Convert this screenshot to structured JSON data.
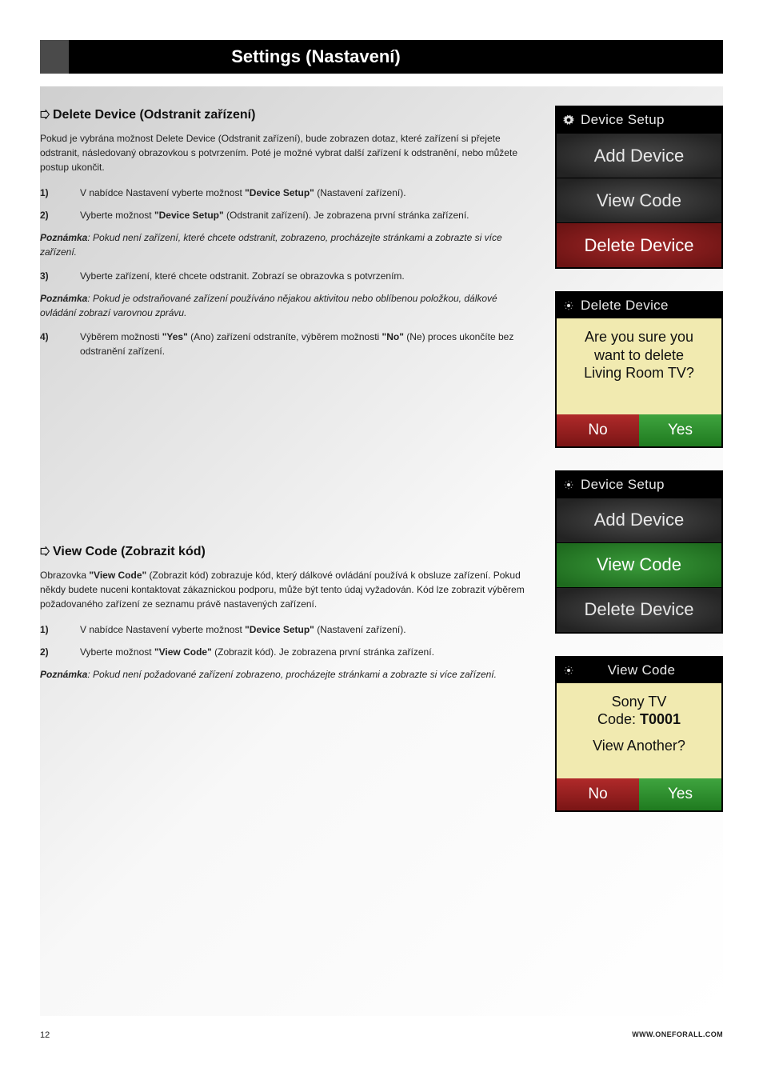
{
  "header": {
    "title": "Settings (Nastavení)"
  },
  "section1": {
    "heading": "Delete Device (Odstranit zařízení)",
    "intro": "Pokud je vybrána možnost Delete Device (Odstranit zařízení), bude zobrazen dotaz, které zařízení si přejete odstranit, následovaný obrazovkou s potvrzením. Poté je možné vybrat další zařízení k odstranění, nebo můžete postup ukončit.",
    "steps": [
      {
        "n": "1)",
        "pre": "V nabídce Nastavení vyberte možnost ",
        "bold": "\"Device Setup\"",
        "post": " (Nastavení zařízení)."
      },
      {
        "n": "2)",
        "pre": "Vyberte možnost ",
        "bold": "\"Device Setup\"",
        "post": " (Odstranit zařízení). Je zobrazena první stránka zařízení."
      }
    ],
    "note1_label": "Poznámka",
    "note1_text": ": Pokud není zařízení, které chcete odstranit, zobrazeno, procházejte stránkami a zobrazte si více zařízení.",
    "step3": {
      "n": "3)",
      "text": "Vyberte zařízení, které chcete odstranit. Zobrazí se obrazovka s potvrzením."
    },
    "note2_label": "Poznámka",
    "note2_text": ": Pokud je odstraňované zařízení používáno nějakou aktivitou nebo oblíbenou položkou, dálkové ovládání zobrazí varovnou zprávu.",
    "step4": {
      "n": "4)",
      "pre": "Výběrem možnosti ",
      "b1": "\"Yes\"",
      "mid": " (Ano) zařízení odstraníte, výběrem možnosti ",
      "b2": "\"No\"",
      "post": " (Ne) proces ukončíte bez odstranění zařízení."
    }
  },
  "section2": {
    "heading": "View Code (Zobrazit kód)",
    "intro_pre": "Obrazovka ",
    "intro_bold": "\"View Code\"",
    "intro_post": " (Zobrazit kód) zobrazuje kód, který dálkové ovládání používá k obsluze zařízení. Pokud někdy budete nuceni kontaktovat zákaznickou podporu, může být tento údaj vyžadován.  Kód lze zobrazit výběrem požadovaného zařízení ze seznamu právě nastavených zařízení.",
    "steps": [
      {
        "n": "1)",
        "pre": "V nabídce Nastavení vyberte možnost ",
        "bold": "\"Device Setup\"",
        "post": " (Nastavení zařízení)."
      },
      {
        "n": "2)",
        "pre": "Vyberte možnost ",
        "bold": "\"View Code\"",
        "post": " (Zobrazit kód). Je zobrazena první stránka zařízení."
      }
    ],
    "note_label": "Poznámka",
    "note_text": ": Pokud není požadované zařízení zobrazeno, procházejte stránkami a zobrazte si více zařízení."
  },
  "screens": {
    "s1": {
      "title": "Device Setup",
      "items": [
        "Add Device",
        "View Code",
        "Delete Device"
      ],
      "highlight": 2
    },
    "s2": {
      "title": "Delete Device",
      "body_lines": [
        "Are you sure you",
        "want to delete",
        "Living Room TV?"
      ],
      "no": "No",
      "yes": "Yes"
    },
    "s3": {
      "title": "Device Setup",
      "items": [
        "Add Device",
        "View Code",
        "Delete Device"
      ],
      "highlight": 1
    },
    "s4": {
      "title": "View Code",
      "line1": "Sony TV",
      "code_label": "Code: ",
      "code": "T0001",
      "another": "View Another?",
      "no": "No",
      "yes": "Yes"
    }
  },
  "footer": {
    "page": "12",
    "url": "WWW.ONEFORALL.COM"
  }
}
